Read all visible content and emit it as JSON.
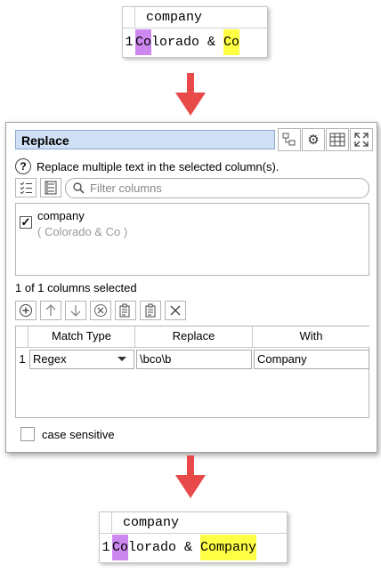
{
  "before_table": {
    "column_header": "company",
    "row_number": "1",
    "cell_parts": [
      "Co",
      "lorado & ",
      "Co"
    ]
  },
  "after_table": {
    "column_header": "company",
    "row_number": "1",
    "cell_parts": [
      "Co",
      "lorado & ",
      "Company"
    ]
  },
  "dialog": {
    "title": "Replace",
    "help_text": "Replace multiple text in the selected column(s).",
    "filter_placeholder": "Filter columns",
    "columns": [
      {
        "name": "company",
        "sample": "( Colorado & Co )",
        "checked": "✓"
      }
    ],
    "selected_count": "1 of 1 columns selected",
    "grid": {
      "headers": [
        "Match Type",
        "Replace",
        "With"
      ],
      "rows": [
        {
          "num": "1",
          "match_type": "Regex",
          "replace": "\\bco\\b",
          "with": "Company"
        }
      ]
    },
    "case_sensitive_label": "case sensitive"
  },
  "colors": {
    "highlight_purple": "#cc88ee",
    "highlight_yellow": "#ffff44",
    "arrow_red": "#e84a4a",
    "title_bg": "#cfe0f4"
  },
  "icons": {
    "toolbar": [
      "node-icon",
      "gear-icon",
      "table-icon",
      "expand-icon"
    ],
    "list_tools": [
      "checklist-icon",
      "list-icon",
      "search-icon"
    ],
    "row_tools": [
      "add-icon",
      "up-icon",
      "down-icon",
      "remove-icon",
      "paste-icon",
      "copy-icon",
      "clear-icon"
    ]
  }
}
